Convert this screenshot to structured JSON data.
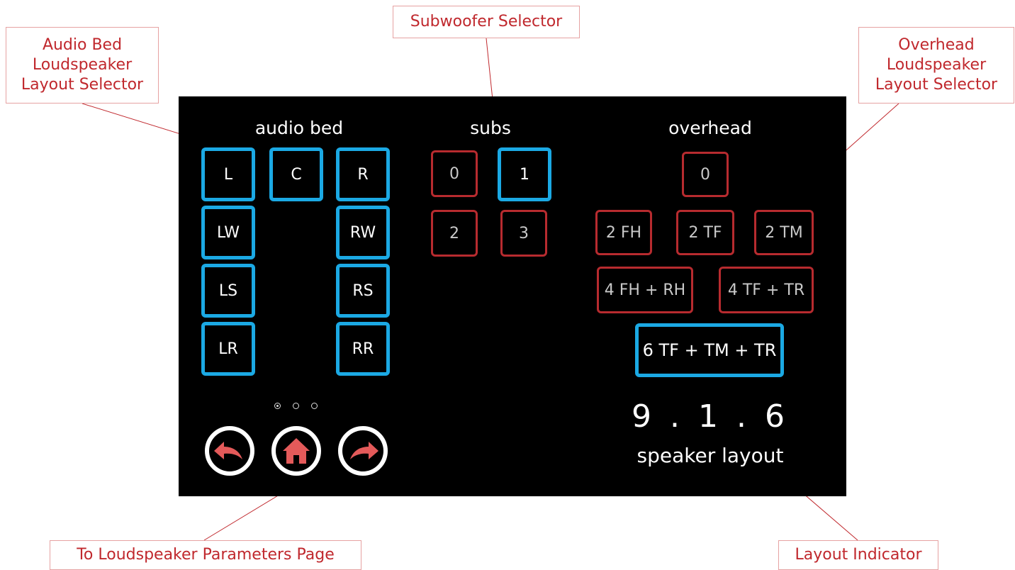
{
  "callouts": {
    "audio_bed": "Audio Bed\nLoudspeaker\nLayout Selector",
    "subwoofer": "Subwoofer Selector",
    "overhead": "Overhead\nLoudspeaker\nLayout Selector",
    "params": "To Loudspeaker Parameters Page",
    "indicator": "Layout Indicator"
  },
  "screen": {
    "audio_bed_title": "audio bed",
    "subs_title": "subs",
    "overhead_title": "overhead",
    "audio_bed": {
      "L": "L",
      "C": "C",
      "R": "R",
      "LW": "LW",
      "RW": "RW",
      "LS": "LS",
      "RS": "RS",
      "LR": "LR",
      "RR": "RR"
    },
    "subs": {
      "s0": "0",
      "s1": "1",
      "s2": "2",
      "s3": "3"
    },
    "overhead": {
      "o0": "0",
      "fh2": "2 FH",
      "tf2": "2 TF",
      "tm2": "2 TM",
      "fhrh4": "4 FH + RH",
      "tftr4": "4 TF + TR",
      "tftmtr6": "6 TF + TM + TR"
    },
    "layout_value": "9 . 1 . 6",
    "layout_label": "speaker layout"
  },
  "colors": {
    "active": "#1ba9e4",
    "inactive": "#b72b2f",
    "callout_text": "#c0282d",
    "nav_icon": "#e45a5a"
  },
  "icons": {
    "back": "back-arrow-icon",
    "home": "home-icon",
    "forward": "forward-arrow-icon"
  }
}
